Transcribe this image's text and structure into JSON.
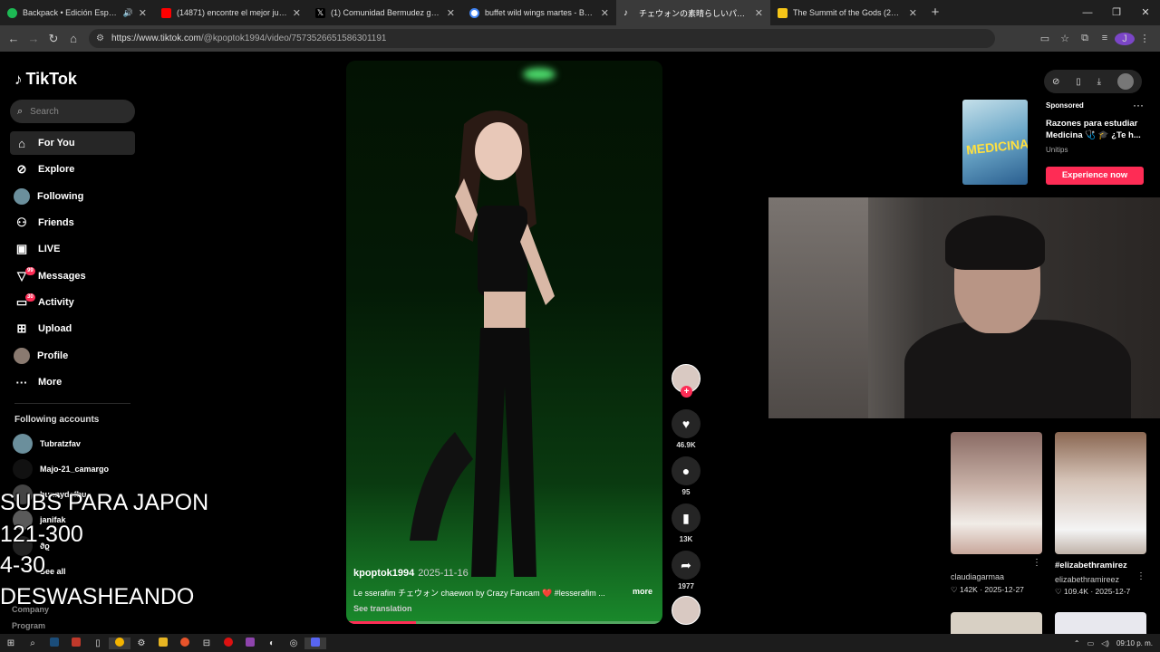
{
  "browser": {
    "tabs": [
      {
        "title": "Backpack • Edición Especial",
        "color": "#1db954",
        "audio": true
      },
      {
        "title": "(14871) encontre el mejor juego",
        "color": "#ff0000"
      },
      {
        "title": "(1) Comunidad Bermudez gang",
        "color": "#dddddd"
      },
      {
        "title": "buffet wild wings martes - Busc",
        "color": "#4285f4"
      },
      {
        "title": "チェウォンの素晴らしいパフォーマンス",
        "color": "#ffffff",
        "active": true
      },
      {
        "title": "The Summit of the Gods (2021)",
        "color": "#f5c518"
      }
    ],
    "url_host": "https://www.tiktok.com",
    "url_path": "/@kpoptok1994/video/7573526651586301191",
    "profile_initial": "J"
  },
  "sidebar": {
    "logo": "TikTok",
    "search_placeholder": "Search",
    "nav": [
      {
        "label": "For You",
        "icon": "home-icon"
      },
      {
        "label": "Explore",
        "icon": "compass-icon"
      },
      {
        "label": "Following",
        "icon": "avatar"
      },
      {
        "label": "Friends",
        "icon": "friends-icon"
      },
      {
        "label": "LIVE",
        "icon": "live-icon"
      },
      {
        "label": "Messages",
        "icon": "message-icon",
        "badge": "99"
      },
      {
        "label": "Activity",
        "icon": "activity-icon",
        "badge": "30"
      },
      {
        "label": "Upload",
        "icon": "upload-icon"
      },
      {
        "label": "Profile",
        "icon": "profile-icon"
      },
      {
        "label": "More",
        "icon": "more-icon"
      }
    ],
    "following_title": "Following accounts",
    "accounts": [
      "Tubratzfav",
      "Majo-21_camargo",
      "bunnydefbu",
      "janifak",
      "ϑϱ"
    ],
    "see_all": "See all",
    "footer": [
      "Company",
      "Program"
    ]
  },
  "overlay_lines": [
    "SUBS PARA JAPON",
    "121-300",
    "4-30",
    "DESWASHEANDO"
  ],
  "video": {
    "username": "kpoptok1994",
    "date": "2025-11-16",
    "caption": "Le sserafim チェウォン chaewon by Crazy Fancam ❤️ #lesserafim ...",
    "more": "more",
    "see_translation": "See translation",
    "progress": 0.22
  },
  "actions": {
    "likes": "46.9K",
    "comments": "95",
    "saves": "13K",
    "shares": "1977"
  },
  "ad": {
    "label": "Sponsored",
    "title": "Razones para estudiar Medicina 🩺 🎓 ¿Te h...",
    "sponsor": "Unitips",
    "cta": "Experience now",
    "image_text": "MEDICINA"
  },
  "recommended": [
    {
      "title": "",
      "user": "claudiagarmaa",
      "likes": "142K",
      "date": "2025-12-27"
    },
    {
      "title": "#elizabethramirez",
      "user": "elizabethramireez",
      "likes": "109.4K",
      "date": "2025-12-7"
    }
  ],
  "taskbar": {
    "clock": "09:10 p. m."
  }
}
